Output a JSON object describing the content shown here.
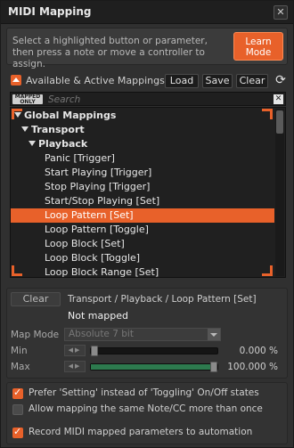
{
  "window": {
    "title": "MIDI Mapping",
    "close_glyph": "✕"
  },
  "info": {
    "text": "Select a highlighted button or parameter, then press a note or move a controller to assign.",
    "learn_button": "Learn Mode"
  },
  "mappings": {
    "header": "Available & Active Mappings",
    "load": "Load",
    "save": "Save",
    "clear": "Clear",
    "refresh_glyph": "⟳"
  },
  "search": {
    "badge": "MAPPED ONLY",
    "placeholder": "Search",
    "clear_glyph": "✕"
  },
  "tree": {
    "rows": [
      {
        "label": "Global Mappings",
        "level": 0,
        "bold": true,
        "expanded": true
      },
      {
        "label": "Transport",
        "level": 1,
        "bold": true,
        "expanded": true
      },
      {
        "label": "Playback",
        "level": 2,
        "bold": true,
        "expanded": true
      },
      {
        "label": "Panic [Trigger]",
        "level": 3
      },
      {
        "label": "Start Playing [Trigger]",
        "level": 3
      },
      {
        "label": "Stop Playing [Trigger]",
        "level": 3
      },
      {
        "label": "Start/Stop Playing [Set]",
        "level": 3
      },
      {
        "label": "Loop Pattern [Set]",
        "level": 3,
        "selected": true
      },
      {
        "label": "Loop Pattern [Toggle]",
        "level": 3
      },
      {
        "label": "Loop Block [Set]",
        "level": 3
      },
      {
        "label": "Loop Block [Toggle]",
        "level": 3
      },
      {
        "label": "Loop Block Range [Set]",
        "level": 3
      }
    ]
  },
  "detail": {
    "clear": "Clear",
    "path": "Transport / Playback / Loop Pattern [Set]",
    "status": "Not mapped",
    "map_mode_label": "Map Mode",
    "map_mode_value": "Absolute 7 bit",
    "min_label": "Min",
    "min_value": "0.000 %",
    "min_level": 0.0,
    "max_label": "Max",
    "max_value": "100.000 %",
    "max_level": 1.0
  },
  "options": [
    {
      "label": "Prefer 'Setting' instead of 'Toggling' On/Off states",
      "checked": true
    },
    {
      "label": "Allow mapping the same Note/CC more than once",
      "checked": false
    },
    {
      "label": "Record MIDI mapped parameters to automation",
      "checked": true
    }
  ],
  "colors": {
    "accent": "#e8612a",
    "slider_fill": "#2d7a4e"
  }
}
